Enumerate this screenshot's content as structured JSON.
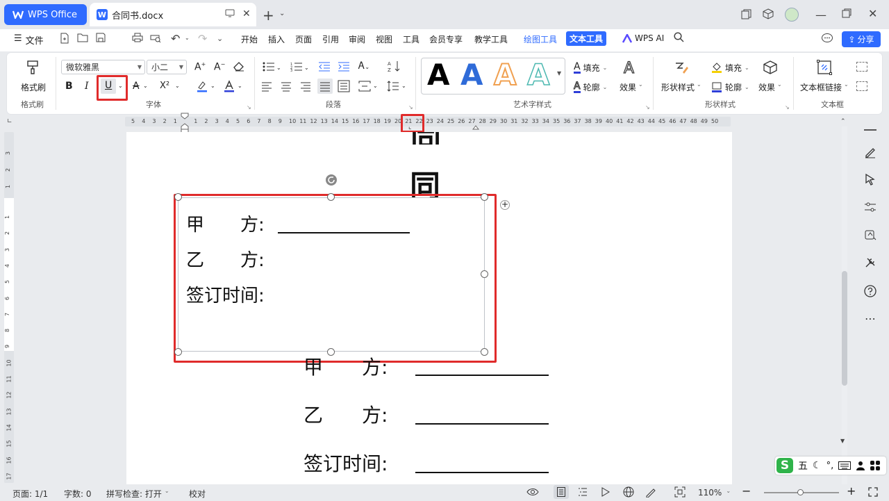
{
  "titlebar": {
    "app_tab": "WPS Office",
    "doc_tab": "合同书.docx"
  },
  "menubar": {
    "file": "文件",
    "items": [
      "开始",
      "插入",
      "页面",
      "引用",
      "审阅",
      "视图",
      "工具",
      "会员专享",
      "教学工具",
      "绘图工具",
      "文本工具"
    ],
    "wps_ai": "WPS AI",
    "share": "分享"
  },
  "ribbon": {
    "format_painter": "格式刷",
    "group_format_painter": "格式刷",
    "font_name": "微软雅黑",
    "font_size": "小二",
    "bold": "B",
    "italic": "I",
    "underline": "U",
    "strike": "A",
    "superscript": "X²",
    "group_font": "字体",
    "group_paragraph": "段落",
    "art_style_letter": "A",
    "group_art": "艺术字样式",
    "fill": "填充",
    "outline": "轮廓",
    "effect": "效果",
    "shape_style": "形状样式",
    "shape_fill": "填充",
    "shape_outline": "轮廓",
    "shape_effect": "效果",
    "group_shape_style": "形状样式",
    "textbox_link": "文本框链接",
    "group_textbox": "文本框"
  },
  "ruler": {
    "left_numbers": [
      "5",
      "4",
      "3",
      "2",
      "1"
    ],
    "numbers": [
      "1",
      "2",
      "3",
      "4",
      "5",
      "6",
      "7",
      "8",
      "9",
      "10",
      "11",
      "12",
      "13",
      "14",
      "15",
      "16",
      "17",
      "18",
      "19",
      "20",
      "21",
      "22",
      "23",
      "24",
      "25",
      "26",
      "27",
      "28",
      "29",
      "30",
      "31",
      "32",
      "33",
      "34",
      "35",
      "36",
      "37",
      "38",
      "39",
      "40",
      "41",
      "42",
      "43",
      "44",
      "45",
      "46",
      "47",
      "48",
      "49",
      "50"
    ],
    "vertical_top": [
      "3",
      "2",
      "1"
    ],
    "vertical_numbers": [
      "1",
      "2",
      "3",
      "4",
      "5",
      "6",
      "7",
      "8",
      "9",
      "10",
      "11",
      "12",
      "13",
      "14",
      "15",
      "16",
      "17"
    ]
  },
  "document": {
    "title_char": "同",
    "textbox": {
      "party_a": "甲　　方:",
      "party_b": "乙　　方:",
      "sign_time": "签订时间:"
    },
    "body": {
      "party_a": "甲　　方:",
      "party_b": "乙　　方:",
      "sign_time": "签订时间:"
    }
  },
  "ime": {
    "logo": "S",
    "mode": "五"
  },
  "status": {
    "page": "页面: 1/1",
    "words": "字数: 0",
    "spellcheck": "拼写检查: 打开",
    "proofread": "校对",
    "zoom": "110%"
  },
  "colors": {
    "accent": "#2f6bff",
    "highlight_red": "#e02b2b",
    "art_blue": "#2f6bd8",
    "art_orange": "#f0a050",
    "art_teal": "#4bb8b0"
  }
}
